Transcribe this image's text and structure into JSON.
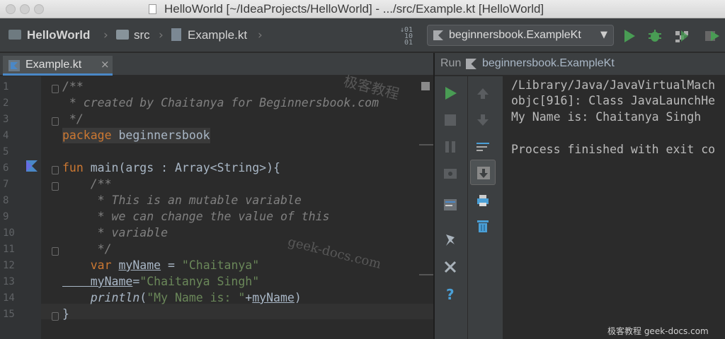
{
  "window": {
    "title": "HelloWorld [~/IdeaProjects/HelloWorld] - .../src/Example.kt [HelloWorld]"
  },
  "navbar": {
    "breadcrumbs": [
      "HelloWorld",
      "src",
      "Example.kt"
    ],
    "run_config": "beginnersbook.ExampleKt"
  },
  "editor": {
    "tab_label": "Example.kt",
    "line_numbers": [
      "1",
      "2",
      "3",
      "4",
      "5",
      "6",
      "7",
      "8",
      "9",
      "10",
      "11",
      "12",
      "13",
      "14",
      "15"
    ],
    "lines": {
      "l1": "/**",
      "l2": " * created by Chaitanya for Beginnersbook.com",
      "l3": " */",
      "l4_kw": "package",
      "l4_name": " beginnersbook",
      "l6_kw": "fun",
      "l6_rest": " main(args : Array<String>){",
      "l7": "    /**",
      "l8": "     * This is an mutable variable",
      "l9": "     * we can change the value of this",
      "l10": "     * variable",
      "l11": "     */",
      "l12_kw": "    var ",
      "l12_var": "myName",
      "l12_eq": " = ",
      "l12_str": "\"Chaitanya\"",
      "l13_var": "    myName",
      "l13_eq": "=",
      "l13_str": "\"Chaitanya Singh\"",
      "l14_fn": "    println",
      "l14_open": "(",
      "l14_str": "\"My Name is: \"",
      "l14_plus": "+",
      "l14_var": "myName",
      "l14_close": ")",
      "l15": "}"
    }
  },
  "run_panel": {
    "label": "Run",
    "config": "beginnersbook.ExampleKt",
    "console": [
      "/Library/Java/JavaVirtualMach",
      "objc[916]: Class JavaLaunchHe",
      "My Name is: Chaitanya Singh",
      "",
      "Process finished with exit co"
    ]
  },
  "watermarks": {
    "cn": "极客教程",
    "site": "geek-docs.com",
    "footer": "极客教程 geek-docs.com"
  },
  "colors": {
    "accent_blue": "#4a88c7",
    "run_green": "#499c54",
    "keyword": "#cc7832",
    "string": "#6a8759",
    "comment": "#808080"
  }
}
